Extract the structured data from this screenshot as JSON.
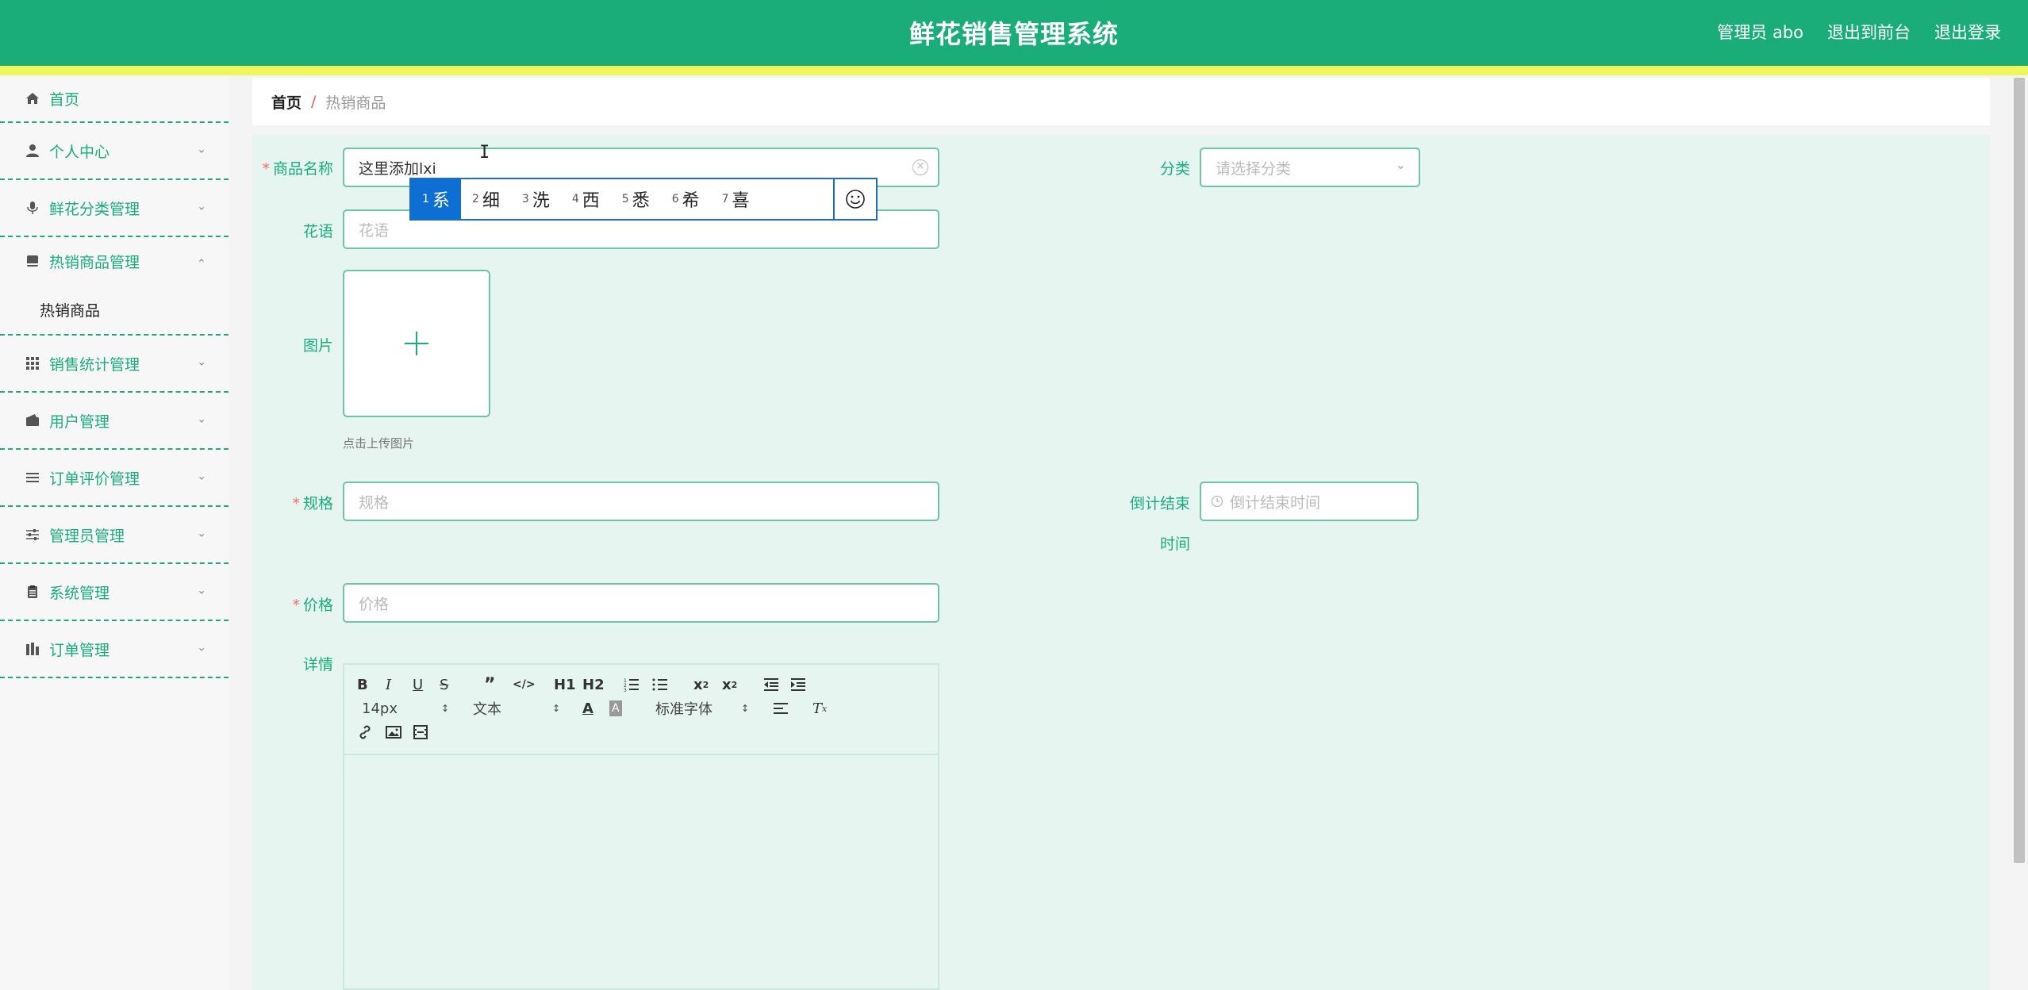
{
  "header": {
    "title": "鲜花销售管理系统",
    "user": "管理员 abo",
    "to_front": "退出到前台",
    "logout": "退出登录"
  },
  "sidebar": {
    "items": [
      {
        "label": "首页",
        "icon": "home-icon"
      },
      {
        "label": "个人中心",
        "icon": "user-icon"
      },
      {
        "label": "鲜花分类管理",
        "icon": "microphone-icon"
      },
      {
        "label": "热销商品管理",
        "icon": "book-icon"
      },
      {
        "label": "销售统计管理",
        "icon": "grid-icon"
      },
      {
        "label": "用户管理",
        "icon": "wallet-icon"
      },
      {
        "label": "订单评价管理",
        "icon": "list-icon"
      },
      {
        "label": "管理员管理",
        "icon": "sliders-icon"
      },
      {
        "label": "系统管理",
        "icon": "clipboard-icon"
      },
      {
        "label": "订单管理",
        "icon": "chart-icon"
      }
    ],
    "submenu_label": "热销商品"
  },
  "breadcrumb": {
    "home": "首页",
    "separator": "/",
    "current": "热销商品"
  },
  "form": {
    "name_label": "商品名称",
    "name_value": "这里添加lxi",
    "category_label": "分类",
    "category_placeholder": "请选择分类",
    "flower_lang_label": "花语",
    "flower_lang_placeholder": "花语",
    "image_label": "图片",
    "upload_hint": "点击上传图片",
    "spec_label": "规格",
    "spec_placeholder": "规格",
    "countdown_label_1": "倒计结束",
    "countdown_label_2": "时间",
    "countdown_placeholder": "倒计结束时间",
    "price_label": "价格",
    "price_placeholder": "价格",
    "detail_label": "详情"
  },
  "ime": {
    "candidates": [
      {
        "num": "1",
        "char": "系"
      },
      {
        "num": "2",
        "char": "细"
      },
      {
        "num": "3",
        "char": "洗"
      },
      {
        "num": "4",
        "char": "西"
      },
      {
        "num": "5",
        "char": "悉"
      },
      {
        "num": "6",
        "char": "希"
      },
      {
        "num": "7",
        "char": "喜"
      }
    ]
  },
  "editor": {
    "font_size": "14px",
    "block_type": "文本",
    "font_family": "标准字体",
    "h1": "H1",
    "h2": "H2"
  },
  "colors": {
    "primary": "#1aad7a",
    "stripe": "#eef65a",
    "panel": "#e6f5ef",
    "required": "#f56c6c"
  }
}
